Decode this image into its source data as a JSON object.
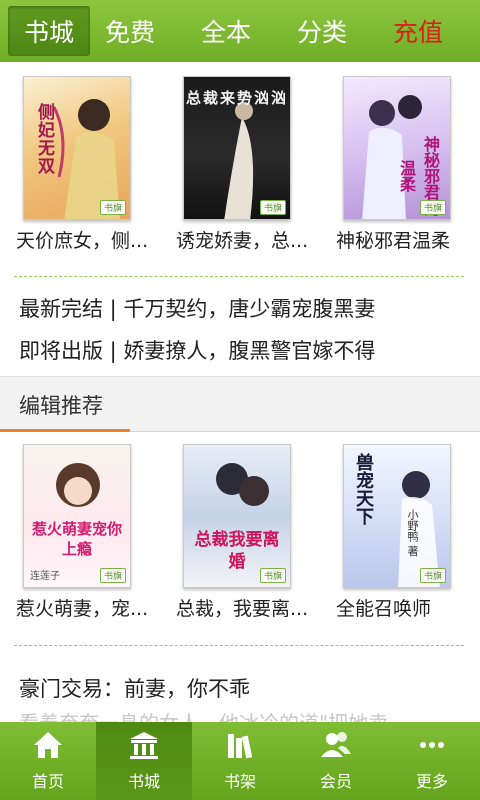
{
  "tabs": [
    {
      "label": "书城",
      "active": true
    },
    {
      "label": "免费"
    },
    {
      "label": "全本"
    },
    {
      "label": "分类"
    },
    {
      "label": "充值",
      "accent": "#d8201c"
    }
  ],
  "top_books": [
    {
      "title": "天价庶女，侧...",
      "cover_text": "侧妃无双"
    },
    {
      "title": "诱宠娇妻，总...",
      "cover_text": "总裁来势汹汹"
    },
    {
      "title": "神秘邪君温柔",
      "cover_text": "神秘邪君的温柔"
    }
  ],
  "promo_links": [
    "最新完结 | 千万契约，唐少霸宠腹黑妻",
    "即将出版 | 娇妻撩人，腹黑警官嫁不得"
  ],
  "editor_section": {
    "title": "编辑推荐"
  },
  "editor_books": [
    {
      "title": "惹火萌妻，宠...",
      "cover_text": "惹火萌妻宠你上瘾",
      "author_text": "连莲子"
    },
    {
      "title": "总裁，我要离...",
      "cover_text": "总裁我要离婚"
    },
    {
      "title": "全能召唤师",
      "cover_text": "兽宠天下",
      "author_text": "小野鸭 著"
    }
  ],
  "featured": {
    "title": "豪门交易：前妻，你不乖",
    "desc": "看着奄奄一息的女人，他冰冷的道\"把她卖"
  },
  "bottom_nav": [
    {
      "label": "首页",
      "icon": "home-icon"
    },
    {
      "label": "书城",
      "icon": "bookstore-icon",
      "active": true
    },
    {
      "label": "书架",
      "icon": "bookshelf-icon"
    },
    {
      "label": "会员",
      "icon": "member-icon"
    },
    {
      "label": "更多",
      "icon": "more-icon"
    }
  ],
  "colors": {
    "brand_green": "#7ebd34",
    "accent_orange": "#f07d1e",
    "recharge_red": "#d8201c"
  }
}
